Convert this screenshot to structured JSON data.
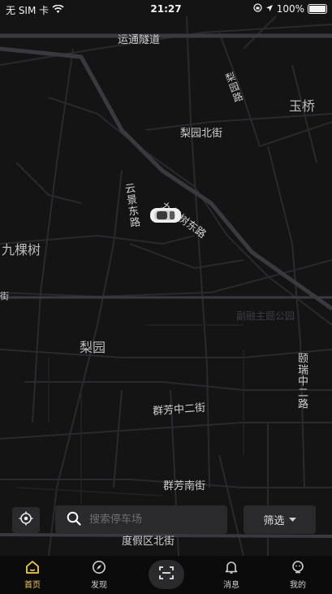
{
  "status_bar": {
    "carrier": "无 SIM 卡",
    "time": "21:27",
    "battery": "100%"
  },
  "map": {
    "labels": {
      "yuntong_tunnel": "运通隧道",
      "liyuan_rd": "梨园路",
      "yuqiao": "玉桥",
      "liyuan_north_st": "梨园北街",
      "yunjing_east_rd": "云景东路",
      "jiukeshu_east_rd": "九棵树东路",
      "jiukeshu": "九棵树",
      "liyuan": "梨园",
      "yirui_middle_2nd_rd": "颐瑞中二路",
      "qunfang_middle_2nd_st": "群芳中二街",
      "qunfang_south_st": "群芳南街",
      "dujiaqu_north_st": "度假区北街",
      "left_edge_fragment": "街",
      "park_faint": "副融主题公园"
    }
  },
  "search": {
    "placeholder": "搜索停车场"
  },
  "filter": {
    "label": "筛选"
  },
  "nav": {
    "home": "首页",
    "discover": "发现",
    "messages": "消息",
    "mine": "我的"
  },
  "colors": {
    "accent": "#f5d130",
    "panel": "#2a2a2c",
    "map_bg": "#141415",
    "road": "#2c2c30",
    "road_major": "#3a3a3e"
  },
  "icons": {
    "locate": "locate-crosshair-icon",
    "search": "search-icon",
    "filter_caret": "caret-down-icon",
    "home": "home-icon",
    "discover": "compass-icon",
    "scan": "scan-icon",
    "messages": "bell-icon",
    "mine": "user-icon",
    "car": "car-icon"
  }
}
